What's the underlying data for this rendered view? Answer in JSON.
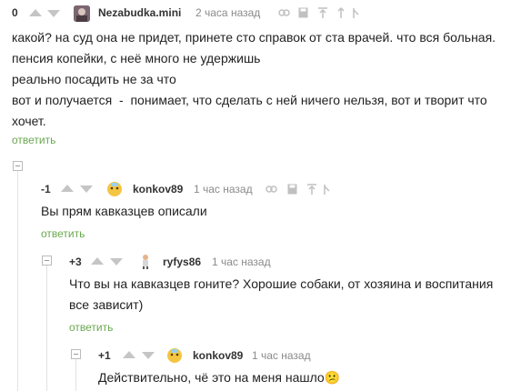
{
  "comments": [
    {
      "rating": "0",
      "username": "Nezabudka.mini",
      "time": "2 часа назад",
      "lines": [
        "какой? на суд она не придет, принете сто справок от ста врачей. что вся больная.",
        "пенсия копейки, с неё много не удержишь",
        "реально посадить не за что",
        "вот и получается  -  понимает, что сделать с ней ничего нельзя, вот и творит что",
        "хочет."
      ],
      "reply_label": "ответить"
    },
    {
      "rating": "-1",
      "username": "konkov89",
      "time": "1 час назад",
      "lines": [
        "Вы прям кавказцев описали"
      ],
      "reply_label": "ответить"
    },
    {
      "rating": "+3",
      "username": "ryfys86",
      "time": "1 час назад",
      "lines": [
        "Что вы на кавказцев гоните? Хорошие собаки, от хозяина и воспитания",
        "все зависит)"
      ],
      "reply_label": "ответить"
    },
    {
      "rating": "+1",
      "username": "konkov89",
      "time": "1 час назад",
      "lines": [
        "Действительно, чё это на меня нашло😕"
      ]
    }
  ],
  "icons": [
    "link-icon",
    "save-icon",
    "parent-up-icon",
    "tree-up-icon",
    "report-icon"
  ],
  "colors": {
    "reply": "#6aa84f",
    "arrow": "#c5c5c5",
    "time": "#8a8a8a"
  }
}
